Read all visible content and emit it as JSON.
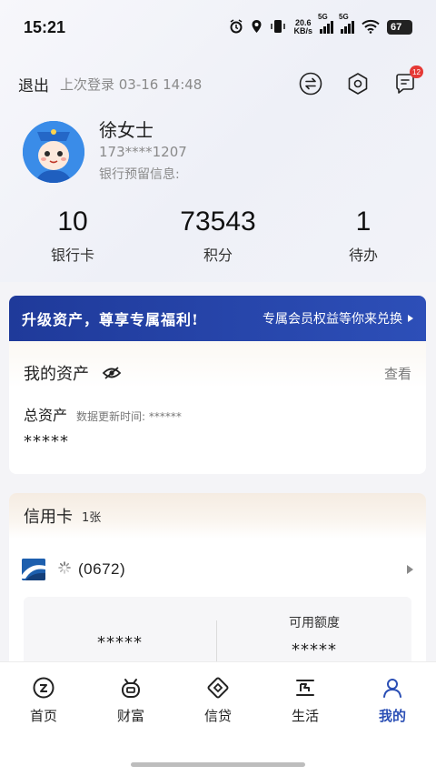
{
  "status_bar": {
    "time": "15:21",
    "net_speed_value": "20.6",
    "net_speed_unit": "KB/s",
    "signal1_label": "5G",
    "signal2_label": "5G",
    "battery": "67"
  },
  "header": {
    "logout_label": "退出",
    "last_login": "上次登录 03-16 14:48",
    "icons": [
      "switch-icon",
      "settings-icon",
      "message-icon"
    ],
    "message_badge": "12"
  },
  "profile": {
    "name": "徐女士",
    "phone": "173****1207",
    "bank_info_label": "银行预留信息:"
  },
  "stats": [
    {
      "value": "10",
      "label": "银行卡"
    },
    {
      "value": "73543",
      "label": "积分"
    },
    {
      "value": "1",
      "label": "待办"
    }
  ],
  "promo": {
    "title": "升级资产，尊享专属福利!",
    "subtitle": "专属会员权益等你来兑换"
  },
  "assets": {
    "title": "我的资产",
    "view_label": "查看",
    "total_label": "总资产",
    "update_time": "数据更新时间: ******",
    "total_value": "*****"
  },
  "credit": {
    "title": "信用卡",
    "count": "1张",
    "card_number": "(0672)",
    "left_value": "*****",
    "available_label": "可用额度",
    "available_value": "*****"
  },
  "nav": {
    "items": [
      {
        "label": "首页",
        "icon": "home-icon"
      },
      {
        "label": "财富",
        "icon": "wealth-icon"
      },
      {
        "label": "信贷",
        "icon": "loan-icon"
      },
      {
        "label": "生活",
        "icon": "life-icon"
      },
      {
        "label": "我的",
        "icon": "profile-icon"
      }
    ],
    "active_color": "#2b4fb5"
  }
}
